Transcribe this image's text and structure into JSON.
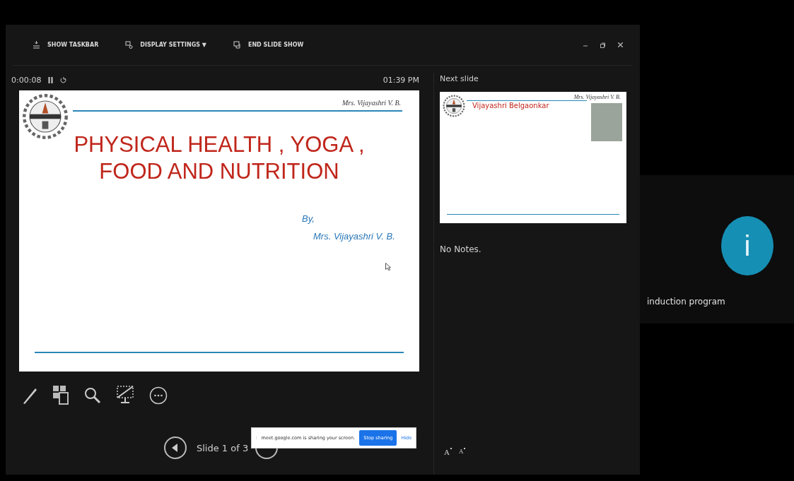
{
  "toolbar": [
    {
      "kind": "taskbar",
      "label": "SHOW TASKBAR"
    },
    {
      "kind": "display",
      "label": "DISPLAY SETTINGS ▼"
    },
    {
      "kind": "end",
      "label": "END SLIDE SHOW"
    }
  ],
  "timer": {
    "elapsed": "0:00:08",
    "clock": "01:39 PM"
  },
  "current_slide": {
    "author": "Mrs. Vijayashri V. B.",
    "title_lines": [
      "PHYSICAL HEALTH , YOGA ,",
      "FOOD AND NUTRITION"
    ],
    "by": "By,",
    "presenter": "Mrs. Vijayashri V. B."
  },
  "next_slide": {
    "label": "Next slide",
    "heading": "Vijayashri Belgaonkar",
    "author": "Mrs. Vijayashri V. B."
  },
  "notes": "No Notes.",
  "navigation": {
    "position": "Slide 1 of 3"
  },
  "share_bar": {
    "message": "meet.google.com is sharing your screen.",
    "stop": "Stop sharing",
    "hide": "Hide"
  },
  "font_size_buttons": [
    {
      "kind": "increase",
      "label": "A"
    },
    {
      "kind": "decrease",
      "label": "A"
    }
  ],
  "participant": {
    "initial": "i",
    "name": "induction program"
  }
}
